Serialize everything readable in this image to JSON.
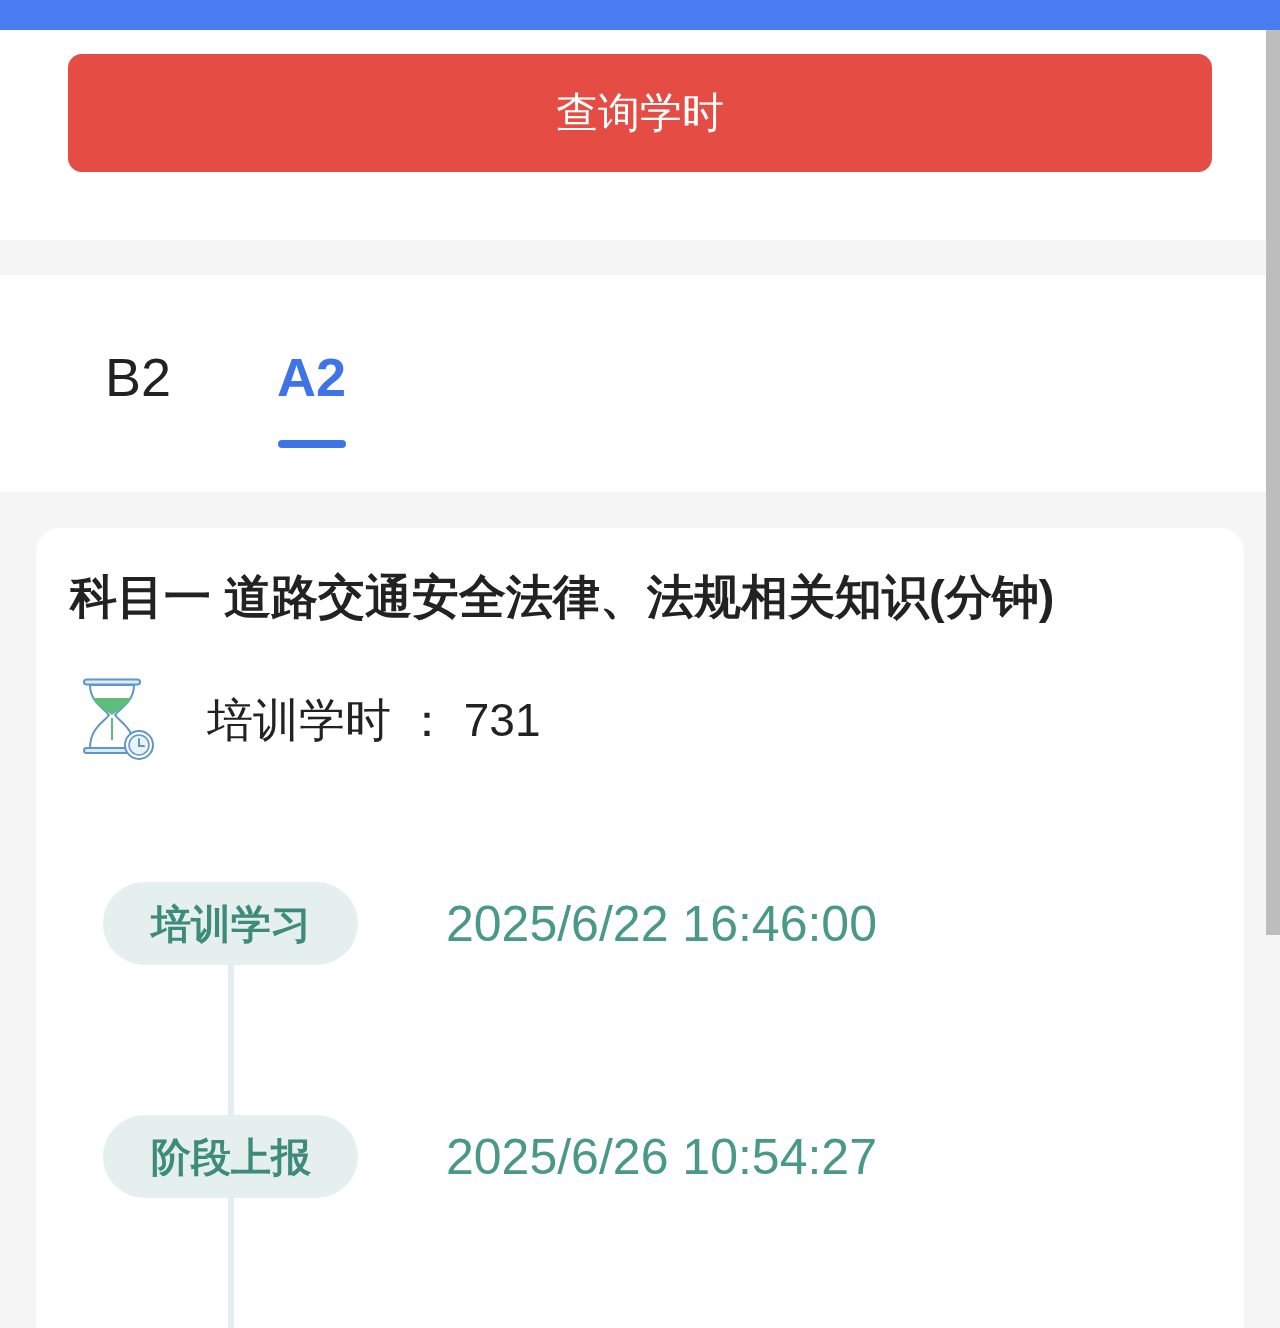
{
  "query_button": {
    "label": "查询学时"
  },
  "tabs": [
    {
      "label": "B2",
      "selected": false
    },
    {
      "label": "A2",
      "selected": true
    }
  ],
  "card": {
    "title": "科目一 道路交通安全法律、法规相关知识(分钟)",
    "hours": {
      "label": "培训学时 ：",
      "value": "731"
    },
    "timeline": [
      {
        "stage": "培训学习",
        "time": "2025/6/22 16:46:00"
      },
      {
        "stage": "阶段上报",
        "time": "2025/6/26 10:54:27"
      }
    ]
  }
}
